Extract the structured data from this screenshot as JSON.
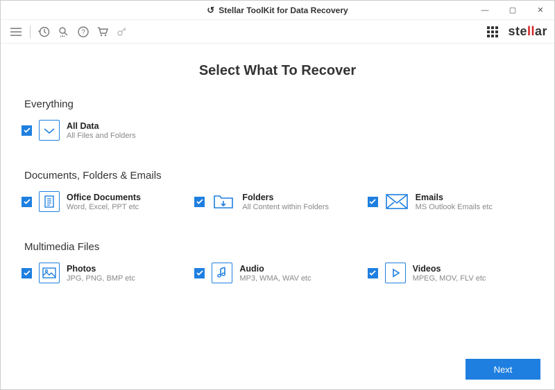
{
  "titlebar": {
    "title": "Stellar ToolKit for Data Recovery"
  },
  "brand": {
    "pre": "ste",
    "mid": "ll",
    "post": "ar"
  },
  "page_title": "Select What To Recover",
  "sections": {
    "everything": {
      "title": "Everything",
      "all_data": {
        "title": "All Data",
        "sub": "All Files and Folders"
      }
    },
    "docs": {
      "title": "Documents, Folders & Emails",
      "office": {
        "title": "Office Documents",
        "sub": "Word, Excel, PPT etc"
      },
      "folders": {
        "title": "Folders",
        "sub": "All Content within Folders"
      },
      "emails": {
        "title": "Emails",
        "sub": "MS Outlook Emails etc"
      }
    },
    "multimedia": {
      "title": "Multimedia Files",
      "photos": {
        "title": "Photos",
        "sub": "JPG, PNG, BMP etc"
      },
      "audio": {
        "title": "Audio",
        "sub": "MP3, WMA, WAV etc"
      },
      "videos": {
        "title": "Videos",
        "sub": "MPEG, MOV, FLV etc"
      }
    }
  },
  "footer": {
    "next": "Next"
  }
}
